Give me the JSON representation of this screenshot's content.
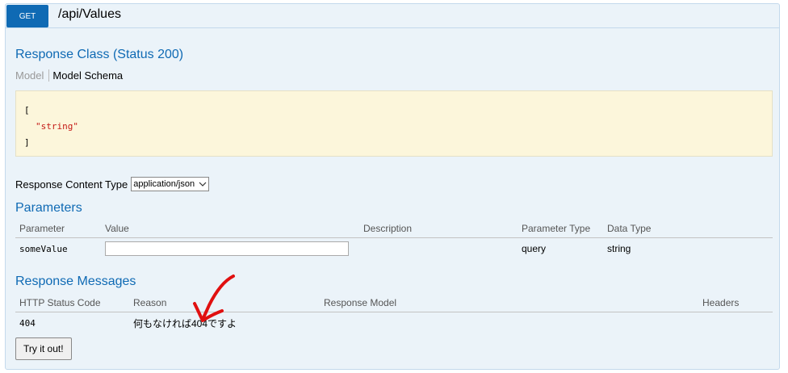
{
  "operation": {
    "method": "GET",
    "path": "/api/Values"
  },
  "response_class": {
    "title": "Response Class (Status 200)",
    "tab_model": "Model",
    "tab_schema": "Model Schema",
    "schema_open": "[",
    "schema_value": "\"string\"",
    "schema_close": "]"
  },
  "content_type": {
    "label": "Response Content Type",
    "selected": "application/json"
  },
  "parameters": {
    "title": "Parameters",
    "headers": [
      "Parameter",
      "Value",
      "Description",
      "Parameter Type",
      "Data Type"
    ],
    "rows": [
      {
        "name": "someValue",
        "value": "",
        "description": "",
        "param_type": "query",
        "data_type": "string"
      }
    ]
  },
  "response_messages": {
    "title": "Response Messages",
    "headers": [
      "HTTP Status Code",
      "Reason",
      "Response Model",
      "Headers"
    ],
    "rows": [
      {
        "code": "404",
        "reason": "何もなければ404ですよ",
        "model": "",
        "headers": ""
      }
    ]
  },
  "try_button": "Try it out!",
  "colors": {
    "method_bg": "#0f6ab4",
    "panel_bg": "#ebf3f9",
    "schema_bg": "#fcf6db",
    "annotation_arrow": "#e01010"
  }
}
